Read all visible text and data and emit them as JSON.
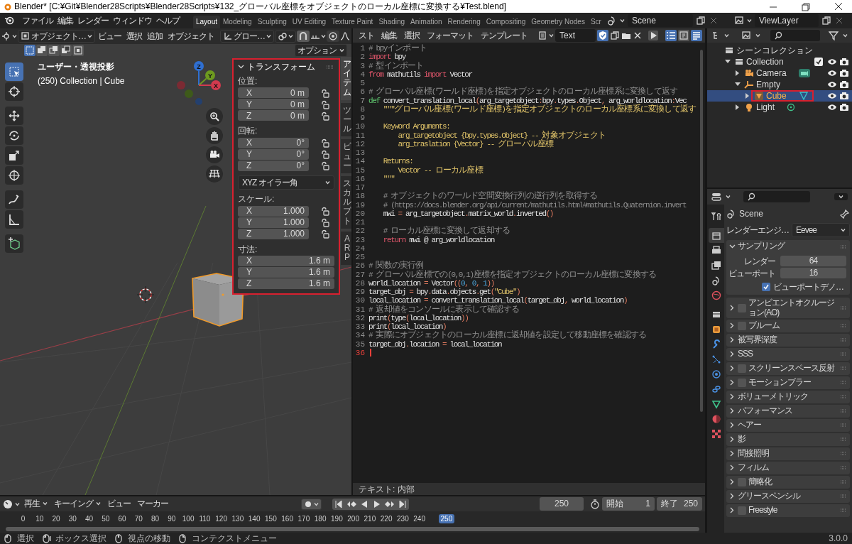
{
  "window": {
    "title": "Blender* [C:¥Git¥Blender28Scripts¥Blender28Scripts¥132_グローバル座標をオブジェクトのローカル座標に変換する¥Test.blend]"
  },
  "topbar": {
    "menus": [
      "ファイル",
      "編集",
      "レンダー",
      "ウィンドウ",
      "ヘルプ"
    ],
    "workspaces": [
      {
        "label": "Layout",
        "selected": true
      },
      {
        "label": "Modeling",
        "selected": false
      },
      {
        "label": "Sculpting",
        "selected": false
      },
      {
        "label": "UV Editing",
        "selected": false
      },
      {
        "label": "Texture Paint",
        "selected": false
      },
      {
        "label": "Shading",
        "selected": false
      },
      {
        "label": "Animation",
        "selected": false
      },
      {
        "label": "Rendering",
        "selected": false
      },
      {
        "label": "Compositing",
        "selected": false
      },
      {
        "label": "Geometry Nodes",
        "selected": false
      },
      {
        "label": "Scr",
        "selected": false
      }
    ],
    "scene": "Scene",
    "view_layer": "ViewLayer"
  },
  "viewport": {
    "mode": "オブジェクト…",
    "menus": [
      "ビュー",
      "選択",
      "追加",
      "オブジェクト"
    ],
    "orientation": "グロー…",
    "snap": true,
    "proportional": false,
    "options": "オプション",
    "select_modes": [
      {
        "kind": "set",
        "selected": true
      },
      {
        "kind": "extend",
        "selected": false
      },
      {
        "kind": "subtract",
        "selected": false
      },
      {
        "kind": "invert",
        "selected": false
      },
      {
        "kind": "intersect",
        "selected": false
      }
    ],
    "tools": [
      {
        "kind": "select",
        "selected": true
      },
      {
        "kind": "cursor",
        "selected": false
      },
      {
        "kind": "move",
        "selected": false
      },
      {
        "kind": "rotate",
        "selected": false
      },
      {
        "kind": "scale",
        "selected": false
      },
      {
        "kind": "transform",
        "selected": false
      },
      {
        "kind": "annotate",
        "selected": false
      },
      {
        "kind": "measure",
        "selected": false
      },
      {
        "kind": "add_cube",
        "selected": false
      }
    ],
    "overlay": [
      "ユーザー・透視投影",
      "(250) Collection | Cube"
    ],
    "gizmo": [
      {
        "label": "Z",
        "color": "#2f6fd1"
      },
      {
        "label": "Y",
        "color": "#6d9a1f"
      },
      {
        "label": "X",
        "color": "#d23a4e"
      }
    ],
    "sidebar_tabs": [
      {
        "label": "アイテム",
        "selected": true
      },
      {
        "label": "ツール",
        "selected": false
      },
      {
        "label": "ビュー",
        "selected": false
      },
      {
        "label": "スカルプト",
        "selected": false
      },
      {
        "label": "ARP",
        "selected": false
      }
    ],
    "transform": {
      "title": "トランスフォーム",
      "highlighted": true,
      "groups": [
        {
          "kind": "vector",
          "label": "位置:",
          "fields": [
            {
              "axis": "X",
              "value": "0 m",
              "locked": false
            },
            {
              "axis": "Y",
              "value": "0 m",
              "locked": false
            },
            {
              "axis": "Z",
              "value": "0 m",
              "locked": false
            }
          ]
        },
        {
          "kind": "vector",
          "label": "回転:",
          "fields": [
            {
              "axis": "X",
              "value": "0°",
              "locked": false
            },
            {
              "axis": "Y",
              "value": "0°",
              "locked": false
            },
            {
              "axis": "Z",
              "value": "0°",
              "locked": false
            }
          ]
        },
        {
          "kind": "dropdown",
          "value": "XYZ オイラー角"
        },
        {
          "kind": "vector",
          "label": "スケール:",
          "fields": [
            {
              "axis": "X",
              "value": "1.000",
              "locked": false
            },
            {
              "axis": "Y",
              "value": "1.000",
              "locked": false
            },
            {
              "axis": "Z",
              "value": "1.000",
              "locked": false
            }
          ]
        },
        {
          "kind": "dimensions",
          "label": "寸法:",
          "fields": [
            {
              "axis": "X",
              "value": "1.6 m"
            },
            {
              "axis": "Y",
              "value": "1.6 m"
            },
            {
              "axis": "Z",
              "value": "1.6 m"
            }
          ]
        }
      ]
    }
  },
  "text_editor": {
    "menus": [
      "スト",
      "編集",
      "選択",
      "フォーマット",
      "テンプレート"
    ],
    "text_name": "Text",
    "register": true,
    "line_numbers": true,
    "word_wrap": false,
    "syntax_highlight": true,
    "footer": "テキスト: 内部",
    "lines": [
      {
        "number": "1",
        "current": false,
        "tokens": [
          {
            "kind": "comment",
            "text": "# bpyインポート"
          }
        ]
      },
      {
        "number": "2",
        "current": false,
        "tokens": [
          {
            "kind": "keyword",
            "text": "import"
          },
          {
            "kind": "plain",
            "text": " bpy"
          }
        ]
      },
      {
        "number": "3",
        "current": false,
        "tokens": [
          {
            "kind": "comment",
            "text": "# 型インポート"
          }
        ]
      },
      {
        "number": "4",
        "current": false,
        "tokens": [
          {
            "kind": "keyword",
            "text": "from"
          },
          {
            "kind": "plain",
            "text": " mathutils "
          },
          {
            "kind": "keyword",
            "text": "import"
          },
          {
            "kind": "plain",
            "text": " Vector"
          }
        ]
      },
      {
        "number": "5",
        "current": false
      },
      {
        "number": "6",
        "current": false,
        "tokens": [
          {
            "kind": "comment",
            "text": "# グローバル座標(ワールド座標)を指定オブジェクトのローカル座標系に変換して返す"
          }
        ]
      },
      {
        "number": "7",
        "current": false,
        "tokens": [
          {
            "kind": "special",
            "text": "def"
          },
          {
            "kind": "plain",
            "text": " convert_translation_local"
          },
          {
            "kind": "punct",
            "text": "("
          },
          {
            "kind": "plain",
            "text": "arg_targetobject"
          },
          {
            "kind": "punct",
            "text": ":"
          },
          {
            "kind": "plain",
            "text": "bpy"
          },
          {
            "kind": "punct",
            "text": "."
          },
          {
            "kind": "plain",
            "text": "types"
          },
          {
            "kind": "punct",
            "text": "."
          },
          {
            "kind": "plain",
            "text": "Object"
          },
          {
            "kind": "punct",
            "text": ","
          },
          {
            "kind": "plain",
            "text": " arg_worldlocation"
          },
          {
            "kind": "punct",
            "text": ":"
          },
          {
            "kind": "plain",
            "text": "Vec"
          }
        ]
      },
      {
        "number": "8",
        "current": false,
        "tokens": [
          {
            "kind": "string",
            "text": "    \"\"\"グローバル座標(ワールド座標)を指定オブジェクトのローカル座標系に変換して返す"
          }
        ]
      },
      {
        "number": "9",
        "current": false
      },
      {
        "number": "10",
        "current": false,
        "tokens": [
          {
            "kind": "string",
            "text": "    Keyword Arguments:"
          }
        ]
      },
      {
        "number": "11",
        "current": false,
        "tokens": [
          {
            "kind": "string",
            "text": "        arg_targetobject {bpy.types.Object} -- 対象オブジェクト"
          }
        ]
      },
      {
        "number": "12",
        "current": false,
        "tokens": [
          {
            "kind": "string",
            "text": "        arg_traslation {Vector} -- グローバル座標"
          }
        ]
      },
      {
        "number": "13",
        "current": false
      },
      {
        "number": "14",
        "current": false,
        "tokens": [
          {
            "kind": "string",
            "text": "    Returns:"
          }
        ]
      },
      {
        "number": "15",
        "current": false,
        "tokens": [
          {
            "kind": "string",
            "text": "        Vector -- ローカル座標"
          }
        ]
      },
      {
        "number": "16",
        "current": false,
        "tokens": [
          {
            "kind": "string",
            "text": "    \"\"\""
          }
        ]
      },
      {
        "number": "17",
        "current": false
      },
      {
        "number": "18",
        "current": false,
        "tokens": [
          {
            "kind": "comment",
            "text": "    # オブジェクトのワールド空間変換行列の逆行列を取得する"
          }
        ]
      },
      {
        "number": "19",
        "current": false,
        "tokens": [
          {
            "kind": "comment",
            "text": "    # (https://docs.blender.org/api/current/mathutils.html#mathutils.Quaternion.invert"
          }
        ]
      },
      {
        "number": "20",
        "current": false,
        "tokens": [
          {
            "kind": "plain",
            "text": "    mwi "
          },
          {
            "kind": "punct",
            "text": "="
          },
          {
            "kind": "plain",
            "text": " arg_targetobject"
          },
          {
            "kind": "punct",
            "text": "."
          },
          {
            "kind": "plain",
            "text": "matrix_world"
          },
          {
            "kind": "punct",
            "text": "."
          },
          {
            "kind": "plain",
            "text": "inverted"
          },
          {
            "kind": "punct",
            "text": "()"
          }
        ]
      },
      {
        "number": "21",
        "current": false
      },
      {
        "number": "22",
        "current": false,
        "tokens": [
          {
            "kind": "comment",
            "text": "    # ローカル座標に変換して返却する"
          }
        ]
      },
      {
        "number": "23",
        "current": false,
        "tokens": [
          {
            "kind": "keyword",
            "text": "    return"
          },
          {
            "kind": "plain",
            "text": " mwi @ arg_worldlocation"
          }
        ]
      },
      {
        "number": "24",
        "current": false
      },
      {
        "number": "25",
        "current": false
      },
      {
        "number": "26",
        "current": false,
        "tokens": [
          {
            "kind": "comment",
            "text": "# 関数の実行例"
          }
        ]
      },
      {
        "number": "27",
        "current": false,
        "tokens": [
          {
            "kind": "comment",
            "text": "# グローバル座標での(0,0,1)座標を指定オブジェクトのローカル座標に変換する"
          }
        ]
      },
      {
        "number": "28",
        "current": false,
        "tokens": [
          {
            "kind": "plain",
            "text": "world_location "
          },
          {
            "kind": "punct",
            "text": "="
          },
          {
            "kind": "plain",
            "text": " Vector"
          },
          {
            "kind": "punct",
            "text": "(("
          },
          {
            "kind": "number",
            "text": "0"
          },
          {
            "kind": "punct",
            "text": ", "
          },
          {
            "kind": "number",
            "text": "0"
          },
          {
            "kind": "punct",
            "text": ", "
          },
          {
            "kind": "number",
            "text": "1"
          },
          {
            "kind": "punct",
            "text": "))"
          }
        ]
      },
      {
        "number": "29",
        "current": false,
        "tokens": [
          {
            "kind": "plain",
            "text": "target_obj "
          },
          {
            "kind": "punct",
            "text": "="
          },
          {
            "kind": "plain",
            "text": " bpy"
          },
          {
            "kind": "punct",
            "text": "."
          },
          {
            "kind": "plain",
            "text": "data"
          },
          {
            "kind": "punct",
            "text": "."
          },
          {
            "kind": "plain",
            "text": "objects"
          },
          {
            "kind": "punct",
            "text": "."
          },
          {
            "kind": "plain",
            "text": "get"
          },
          {
            "kind": "punct",
            "text": "("
          },
          {
            "kind": "string",
            "text": "\"Cube\""
          },
          {
            "kind": "punct",
            "text": ")"
          }
        ]
      },
      {
        "number": "30",
        "current": false,
        "tokens": [
          {
            "kind": "plain",
            "text": "local_location "
          },
          {
            "kind": "punct",
            "text": "="
          },
          {
            "kind": "plain",
            "text": " convert_translation_local"
          },
          {
            "kind": "punct",
            "text": "("
          },
          {
            "kind": "plain",
            "text": "target_obj"
          },
          {
            "kind": "punct",
            "text": ","
          },
          {
            "kind": "plain",
            "text": " world_location"
          },
          {
            "kind": "punct",
            "text": ")"
          }
        ]
      },
      {
        "number": "31",
        "current": false,
        "tokens": [
          {
            "kind": "comment",
            "text": "# 返却値をコンソールに表示して確認する"
          }
        ]
      },
      {
        "number": "32",
        "current": false,
        "tokens": [
          {
            "kind": "plain",
            "text": "print"
          },
          {
            "kind": "punct",
            "text": "("
          },
          {
            "kind": "plain",
            "text": "type"
          },
          {
            "kind": "punct",
            "text": "("
          },
          {
            "kind": "plain",
            "text": "local_location"
          },
          {
            "kind": "punct",
            "text": "))"
          }
        ]
      },
      {
        "number": "33",
        "current": false,
        "tokens": [
          {
            "kind": "plain",
            "text": "print"
          },
          {
            "kind": "punct",
            "text": "("
          },
          {
            "kind": "plain",
            "text": "local_location"
          },
          {
            "kind": "punct",
            "text": ")"
          }
        ]
      },
      {
        "number": "34",
        "current": false,
        "tokens": [
          {
            "kind": "comment",
            "text": "# 実際にオブジェクトのローカル座標に返却値を設定して移動座標を確認する"
          }
        ]
      },
      {
        "number": "35",
        "current": false,
        "tokens": [
          {
            "kind": "plain",
            "text": "target_obj"
          },
          {
            "kind": "punct",
            "text": "."
          },
          {
            "kind": "plain",
            "text": "location "
          },
          {
            "kind": "punct",
            "text": "="
          },
          {
            "kind": "plain",
            "text": " local_location"
          }
        ]
      },
      {
        "number": "36",
        "current": true
      }
    ]
  },
  "outliner": {
    "tree": [
      {
        "label": "シーンコレクション",
        "kind": "scene_collection",
        "children": [
          {
            "label": "Collection",
            "kind": "collection",
            "expanded": true,
            "checked": true,
            "selected": false,
            "children": [
              {
                "label": "Camera",
                "kind": "camera",
                "expanded": false,
                "selected": false
              },
              {
                "label": "Empty",
                "kind": "empty",
                "expanded": true,
                "selected": false,
                "children": [
                  {
                    "label": "Cube",
                    "kind": "mesh",
                    "expanded": false,
                    "selected": true,
                    "highlighted": true
                  }
                ]
              },
              {
                "label": "Light",
                "kind": "light",
                "expanded": false,
                "selected": false
              }
            ]
          }
        ]
      }
    ]
  },
  "properties": {
    "tabs": [
      {
        "kind": "tool",
        "selected": false
      },
      {
        "kind": "render",
        "selected": true
      },
      {
        "kind": "output",
        "selected": false
      },
      {
        "kind": "view_layer",
        "selected": false
      },
      {
        "kind": "scene",
        "selected": false
      },
      {
        "kind": "world",
        "selected": false
      },
      {
        "kind": "collection",
        "selected": false
      },
      {
        "kind": "object",
        "selected": false
      },
      {
        "kind": "modifier",
        "selected": false
      },
      {
        "kind": "particles",
        "selected": false
      },
      {
        "kind": "physics",
        "selected": false
      },
      {
        "kind": "constraints",
        "selected": false
      },
      {
        "kind": "data",
        "selected": false
      },
      {
        "kind": "material",
        "selected": false
      },
      {
        "kind": "texture",
        "selected": false
      }
    ],
    "context": "Scene",
    "engine_label": "レンダーエンジ…",
    "engine": "Eevee",
    "panels": [
      {
        "title": "サンプリング",
        "expanded": true,
        "fields": [
          {
            "label": "レンダー",
            "value": "64"
          },
          {
            "label": "ビューポート",
            "value": "16"
          }
        ],
        "option": {
          "label": "ビューポートデノ…",
          "checked": true
        }
      },
      {
        "title": "アンビエントオクルージョン(AO)",
        "expanded": false,
        "checked": false
      },
      {
        "title": "ブルーム",
        "expanded": false,
        "checked": false
      },
      {
        "title": "被写界深度",
        "expanded": false
      },
      {
        "title": "SSS",
        "expanded": false
      },
      {
        "title": "スクリーンスペース反射",
        "expanded": false,
        "checked": false
      },
      {
        "title": "モーションブラー",
        "expanded": false,
        "checked": false
      },
      {
        "title": "ボリューメトリック",
        "expanded": false
      },
      {
        "title": "パフォーマンス",
        "expanded": false
      },
      {
        "title": "ヘアー",
        "expanded": false
      },
      {
        "title": "影",
        "expanded": false
      },
      {
        "title": "間接照明",
        "expanded": false
      },
      {
        "title": "フィルム",
        "expanded": false
      },
      {
        "title": "簡略化",
        "expanded": false,
        "checked": false
      },
      {
        "title": "グリースペンシル",
        "expanded": false
      },
      {
        "title": "Freestyle",
        "expanded": false,
        "checked": false
      }
    ]
  },
  "timeline": {
    "menus": [
      {
        "label": "再生",
        "dropdown": true
      },
      {
        "label": "キーイング",
        "dropdown": true
      },
      {
        "label": "ビュー",
        "dropdown": false
      },
      {
        "label": "マーカー",
        "dropdown": false
      }
    ],
    "current_frame": "250",
    "start_label": "開始",
    "start": "1",
    "end_label": "終了",
    "end": "250",
    "ticks": [
      "0",
      "10",
      "20",
      "30",
      "40",
      "50",
      "60",
      "70",
      "80",
      "90",
      "100",
      "110",
      "120",
      "130",
      "140",
      "150",
      "160",
      "170",
      "180",
      "190",
      "200",
      "210",
      "220",
      "230",
      "240"
    ],
    "current_badge": "250"
  },
  "status_bar": {
    "hints": [
      {
        "kind": "left",
        "label": "選択"
      },
      {
        "kind": "left_drag",
        "label": "ボックス選択"
      },
      {
        "kind": "middle",
        "label": "視点の移動"
      },
      {
        "kind": "right",
        "label": "コンテクストメニュー"
      }
    ],
    "version": "3.0.0"
  }
}
